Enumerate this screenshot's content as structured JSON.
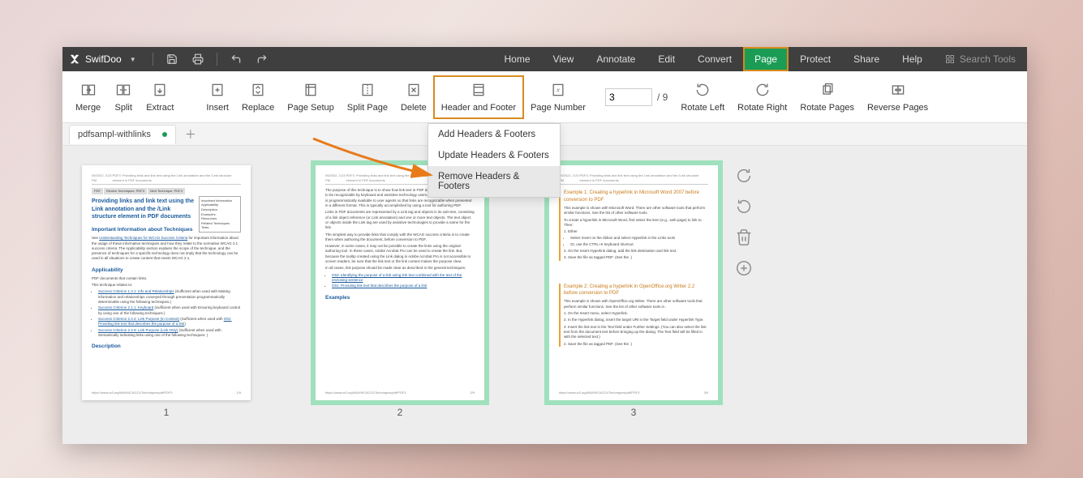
{
  "app": {
    "name": "SwifDoo"
  },
  "titlebar_icons": {
    "save": "save-icon",
    "print": "print-icon",
    "undo": "undo-icon",
    "redo": "redo-icon"
  },
  "menu": {
    "home": "Home",
    "view": "View",
    "annotate": "Annotate",
    "edit": "Edit",
    "convert": "Convert",
    "page": "Page",
    "protect": "Protect",
    "share": "Share",
    "help": "Help"
  },
  "search": {
    "placeholder": "Search Tools"
  },
  "ribbon": {
    "merge": "Merge",
    "split": "Split",
    "extract": "Extract",
    "insert": "Insert",
    "replace": "Replace",
    "page_setup": "Page Setup",
    "split_page": "Split Page",
    "delete": "Delete",
    "header_footer": "Header and Footer",
    "page_number": "Page Number",
    "rotate_left": "Rotate Left",
    "rotate_right": "Rotate Right",
    "rotate_pages": "Rotate Pages",
    "reverse_pages": "Reverse Pages"
  },
  "page_nav": {
    "current": "3",
    "total": "9"
  },
  "header_footer_menu": {
    "add": "Add Headers & Footers",
    "update": "Update Headers & Footers",
    "remove": "Remove Headers & Footers"
  },
  "tabs": {
    "doc1": "pdfsampl-withlinks"
  },
  "thumbs": {
    "p1": "1",
    "p2": "2",
    "p3": "3"
  },
  "doc": {
    "header_time": "09/2022, 3:23 PM",
    "header_title": "PDF3: Providing links and link text using the Link annotation and the /Link structure element in PDF documents",
    "title": "Providing links and link text using the Link annotation and the /Link structure element in PDF documents",
    "h2_info": "Important Information about Techniques",
    "h2_applicability": "Applicability",
    "h2_description": "Description",
    "h2_examples": "Examples",
    "p_intro": "The purpose of this technique is to show how link text in PDF documents can be marked up to be recognizable by keyboard and assistive technology users. That is, the link information is programmatically available to user agents so that links are recognizable when presented in a different format. This is typically accomplished by using a tool for authoring PDF.",
    "p_links": "Links in PDF documents are represented by a Link tag and objects in its sub-tree, consisting of a link object reference (or Link annotation) and one or more text objects. The text object or objects inside the Link tag are used by assistive technologies to provide a name for the link.",
    "p_simplest": "The simplest way to provide links that comply with the WCAG success criteria is to create them when authoring the document, before conversion to PDF.",
    "p_however": "However, in some cases, it may not be possible to create the links using the original authoring tool. In these cases, Adobe Acrobat Pro can be used to create the link. But, because the tooltip created using the Link dialog in Adobe Acrobat Pro is not accessible to screen readers, be sure that the link text or the link context makes the purpose clear.",
    "p_inall": "In all cases, link purpose should be made clear as described in the general techniques:",
    "li_g53": "G53: Identifying the purpose of a link using link text combined with the text of the enclosing sentence",
    "li_g91": "G91: Providing link text that describes the purpose of a link",
    "ex1_title": "Example 1: Creating a hyperlink in Microsoft Word 2007 before conversion to PDF",
    "ex1_body": "This example is shown with Microsoft Word. There are other software tools that perform similar functions. See the list of other software tools.",
    "ex1_step": "To create a hyperlink in Microsoft Word, first select the item (e.g., web page) to link to. Then:",
    "ex1_1": "1. Either",
    "ex1_1a": "Select Insert on the ribbon and select Hyperlink in the Links tools",
    "ex1_1b": "Or, use the CTRL+K keyboard shortcut",
    "ex1_2": "2. On the Insert Hyperlink dialog, add the link destination and link text.",
    "ex1_3": "3. Save the file as tagged PDF. (See the .)",
    "ex2_title": "Example 2: Creating a hyperlink in OpenOffice.org Writer 2.2 before conversion to PDF",
    "ex2_body": "This example is shown with OpenOffice.org Writer. There are other software tools that perform similar functions. See the list of other software tools in .",
    "ex2_1": "1. On the Insert menu, select Hyperlink.",
    "ex2_2": "2. In the Hyperlink dialog, insert the target URI in the Target field under Hyperlink Type.",
    "ex2_3": "3. Insert the link text in the Text field under Further Settings. (You can also select the link text from the document text before bringing up the dialog. The Text field will be filled in with the selected text.)",
    "ex2_4": "4. Save the file as tagged PDF. (See the .)",
    "footer_url": "https://www.w3.org/WAI/WCAG21/Techniques/pdf/PDF3"
  }
}
